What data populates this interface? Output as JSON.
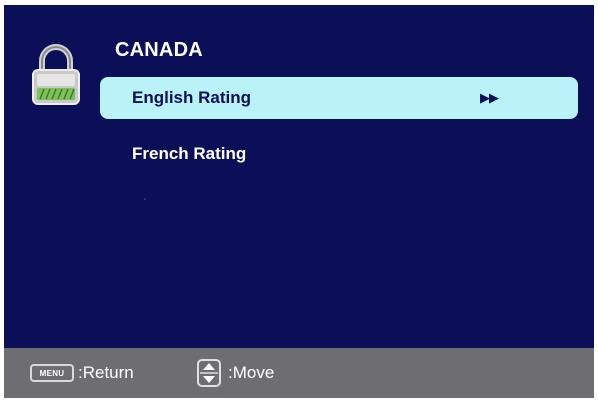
{
  "header": {
    "title": "CANADA"
  },
  "menu": {
    "items": [
      {
        "label": "English Rating",
        "arrow": "▶▶",
        "selected": true
      },
      {
        "label": "French Rating",
        "arrow": "",
        "selected": false
      }
    ]
  },
  "footer": {
    "menu_key_label": "MENU",
    "return_label": ":Return",
    "move_label": ":Move"
  },
  "colors": {
    "background": "#0b0f57",
    "selection": "#b9f2f7",
    "footer": "#6e6e72",
    "lock_accent": "#7ec05a"
  },
  "icons": {
    "lock": "padlock-icon",
    "move": "up-down-arrows-icon"
  }
}
